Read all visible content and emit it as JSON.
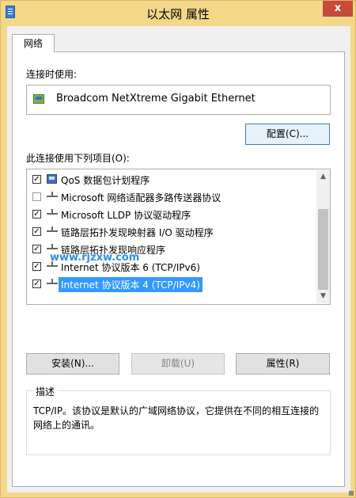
{
  "window": {
    "title": "以太网 属性",
    "close_glyph": "x"
  },
  "tabs": [
    {
      "label": "网络"
    }
  ],
  "connect_using": {
    "label": "连接时使用:",
    "adapter": "Broadcom NetXtreme Gigabit Ethernet"
  },
  "configure_button": "配置(C)...",
  "items_label": "此连接使用下列项目(O):",
  "items": [
    {
      "checked": true,
      "label": "QoS 数据包计划程序",
      "icon": "qos-icon"
    },
    {
      "checked": false,
      "label": "Microsoft 网络适配器多路传送器协议",
      "icon": "protocol-icon"
    },
    {
      "checked": true,
      "label": "Microsoft LLDP 协议驱动程序",
      "icon": "protocol-icon"
    },
    {
      "checked": true,
      "label": "链路层拓扑发现映射器 I/O 驱动程序",
      "icon": "protocol-icon"
    },
    {
      "checked": true,
      "label": "链路层拓扑发现响应程序",
      "icon": "protocol-icon"
    },
    {
      "checked": true,
      "label": "Internet 协议版本 6 (TCP/IPv6)",
      "icon": "protocol-icon"
    },
    {
      "checked": true,
      "label": "Internet 协议版本 4 (TCP/IPv4)",
      "icon": "protocol-icon",
      "selected": true
    }
  ],
  "buttons": {
    "install": "安装(N)...",
    "uninstall": "卸载(U)",
    "properties": "属性(R)"
  },
  "description": {
    "legend": "描述",
    "text": "TCP/IP。该协议是默认的广域网络协议，它提供在不同的相互连接的网络上的通讯。"
  },
  "watermark": "www.rjzxw.com",
  "colors": {
    "window_frame": "#f3d88a",
    "close_button": "#c74a3b",
    "selection": "#3399ff"
  }
}
